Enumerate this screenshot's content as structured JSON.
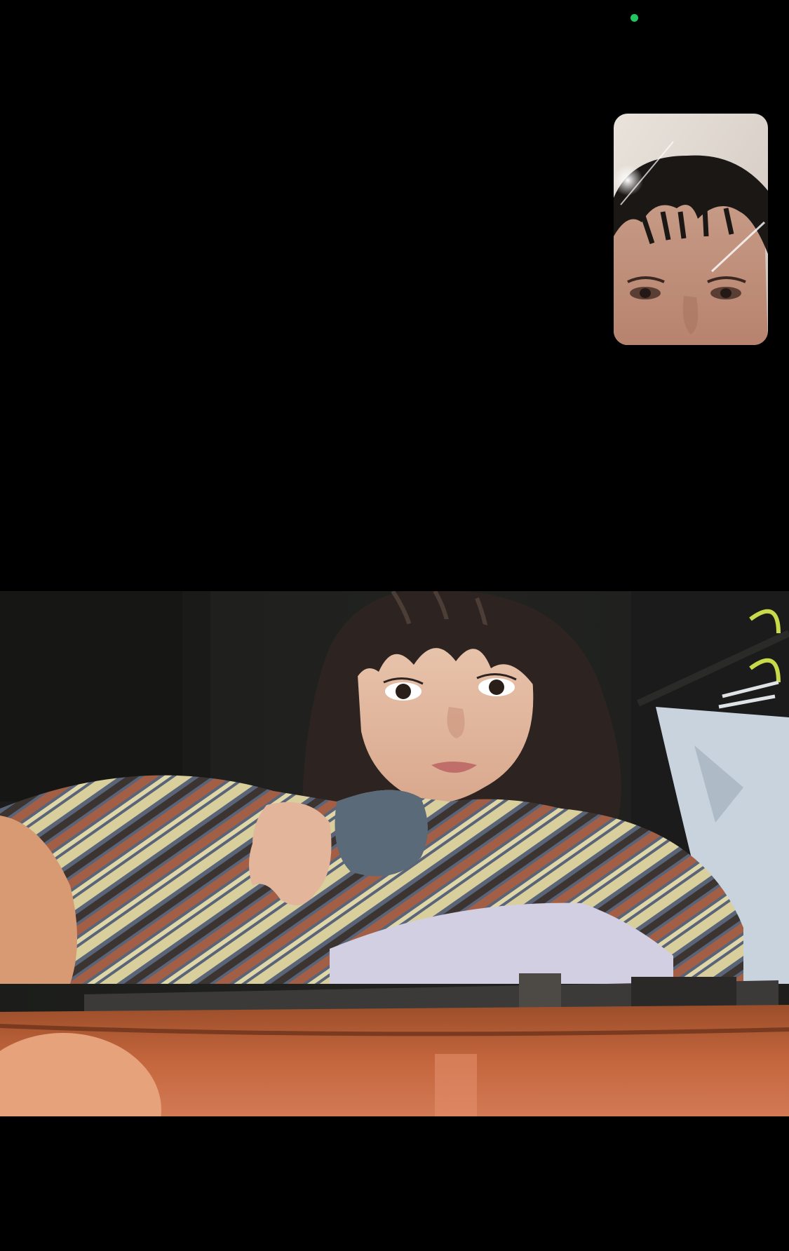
{
  "call": {
    "camera_indicator": {
      "icon": "green-dot-icon",
      "color": "#22c55e"
    },
    "self_view": {
      "description_icon": "self-camera-preview"
    },
    "remote_video": {
      "description_icon": "remote-participant-video"
    }
  }
}
